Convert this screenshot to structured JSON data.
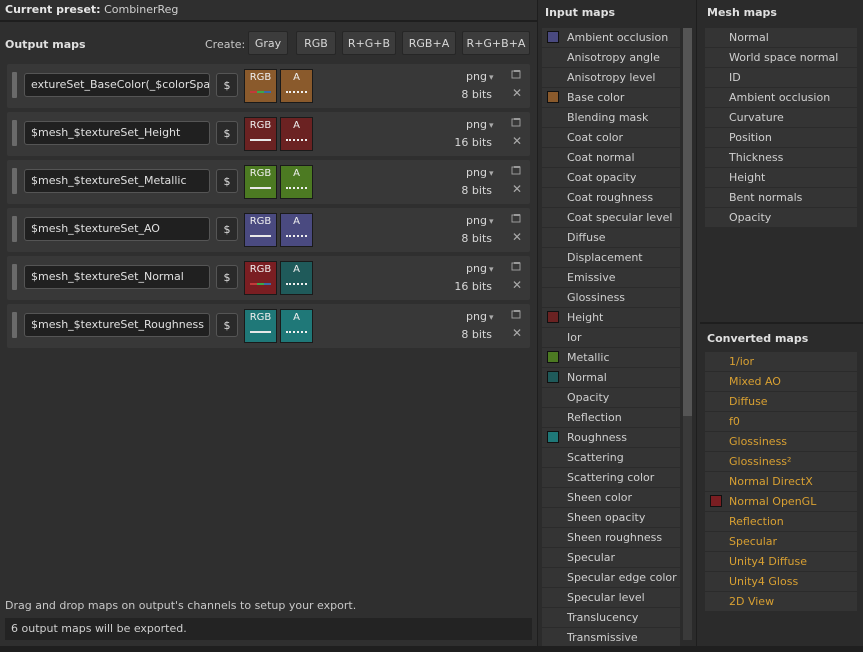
{
  "preset": {
    "label": "Current preset:",
    "value": "CombinerReg"
  },
  "output": {
    "title": "Output maps",
    "create_label": "Create:",
    "create_buttons": [
      "Gray",
      "RGB",
      "R+G+B",
      "RGB+A",
      "R+G+B+A"
    ],
    "rows": [
      {
        "name": "extureSet_BaseColor(_$colorSpace)",
        "c1": "RGB",
        "c2": "A",
        "format": "png",
        "bits": "8 bits",
        "color": "#8a5a2c",
        "c1line": "#3a6aa8",
        "c2line": "dotted"
      },
      {
        "name": "$mesh_$textureSet_Height",
        "c1": "RGB",
        "c2": "A",
        "format": "png",
        "bits": "16 bits",
        "color": "#6b2222",
        "c1line": "#e8e8e8",
        "c2line": "dotted"
      },
      {
        "name": "$mesh_$textureSet_Metallic",
        "c1": "RGB",
        "c2": "A",
        "format": "png",
        "bits": "8 bits",
        "color": "#4c7a22",
        "c1line": "#e8e8e8",
        "c2line": "dotted"
      },
      {
        "name": "$mesh_$textureSet_AO",
        "c1": "RGB",
        "c2": "A",
        "format": "png",
        "bits": "8 bits",
        "color": "#4a4a80",
        "c1line": "#e8e8e8",
        "c2line": "dotted"
      },
      {
        "name": "$mesh_$textureSet_Normal",
        "c1": "RGB",
        "c2": "A",
        "format": "png",
        "bits": "16 bits",
        "color": "#7a1e22",
        "c2color": "#1f5a5a",
        "c1line": "#3a6aa8",
        "c2line": "dotted"
      },
      {
        "name": "$mesh_$textureSet_Roughness",
        "c1": "RGB",
        "c2": "A",
        "format": "png",
        "bits": "8 bits",
        "color": "#1f7878",
        "c1line": "#e8e8e8",
        "c2line": "dotted"
      }
    ],
    "dollar": "$",
    "hint": "Drag and drop maps on output's channels to setup your export.",
    "status": "6 output maps will be exported."
  },
  "input_maps": {
    "title": "Input maps",
    "items": [
      {
        "label": "Ambient occlusion",
        "swatch": "#4a4a80"
      },
      {
        "label": "Anisotropy angle",
        "swatch": ""
      },
      {
        "label": "Anisotropy level",
        "swatch": ""
      },
      {
        "label": "Base color",
        "swatch": "#8a5a2c"
      },
      {
        "label": "Blending mask",
        "swatch": ""
      },
      {
        "label": "Coat color",
        "swatch": ""
      },
      {
        "label": "Coat normal",
        "swatch": ""
      },
      {
        "label": "Coat opacity",
        "swatch": ""
      },
      {
        "label": "Coat roughness",
        "swatch": ""
      },
      {
        "label": "Coat specular level",
        "swatch": ""
      },
      {
        "label": "Diffuse",
        "swatch": ""
      },
      {
        "label": "Displacement",
        "swatch": ""
      },
      {
        "label": "Emissive",
        "swatch": ""
      },
      {
        "label": "Glossiness",
        "swatch": ""
      },
      {
        "label": "Height",
        "swatch": "#6b2222"
      },
      {
        "label": "Ior",
        "swatch": ""
      },
      {
        "label": "Metallic",
        "swatch": "#4c7a22"
      },
      {
        "label": "Normal",
        "swatch": "#1f5a5a"
      },
      {
        "label": "Opacity",
        "swatch": ""
      },
      {
        "label": "Reflection",
        "swatch": ""
      },
      {
        "label": "Roughness",
        "swatch": "#1f7878"
      },
      {
        "label": "Scattering",
        "swatch": ""
      },
      {
        "label": "Scattering color",
        "swatch": ""
      },
      {
        "label": "Sheen color",
        "swatch": ""
      },
      {
        "label": "Sheen opacity",
        "swatch": ""
      },
      {
        "label": "Sheen roughness",
        "swatch": ""
      },
      {
        "label": "Specular",
        "swatch": ""
      },
      {
        "label": "Specular edge color",
        "swatch": ""
      },
      {
        "label": "Specular level",
        "swatch": ""
      },
      {
        "label": "Translucency",
        "swatch": ""
      },
      {
        "label": "Transmissive",
        "swatch": ""
      }
    ]
  },
  "mesh_maps": {
    "title": "Mesh maps",
    "items": [
      "Normal",
      "World space normal",
      "ID",
      "Ambient occlusion",
      "Curvature",
      "Position",
      "Thickness",
      "Height",
      "Bent normals",
      "Opacity"
    ]
  },
  "converted_maps": {
    "title": "Converted maps",
    "items": [
      {
        "label": "1/ior",
        "swatch": ""
      },
      {
        "label": "Mixed AO",
        "swatch": ""
      },
      {
        "label": "Diffuse",
        "swatch": ""
      },
      {
        "label": "f0",
        "swatch": ""
      },
      {
        "label": "Glossiness",
        "swatch": ""
      },
      {
        "label": "Glossiness²",
        "swatch": ""
      },
      {
        "label": "Normal DirectX",
        "swatch": ""
      },
      {
        "label": "Normal OpenGL",
        "swatch": "#7a1e22"
      },
      {
        "label": "Reflection",
        "swatch": ""
      },
      {
        "label": "Specular",
        "swatch": ""
      },
      {
        "label": "Unity4 Diffuse",
        "swatch": ""
      },
      {
        "label": "Unity4 Gloss",
        "swatch": ""
      },
      {
        "label": "2D View",
        "swatch": ""
      }
    ]
  },
  "icons": {
    "folder": "folder-icon",
    "close": "close-icon",
    "dropdown": "chevron-down-icon"
  }
}
